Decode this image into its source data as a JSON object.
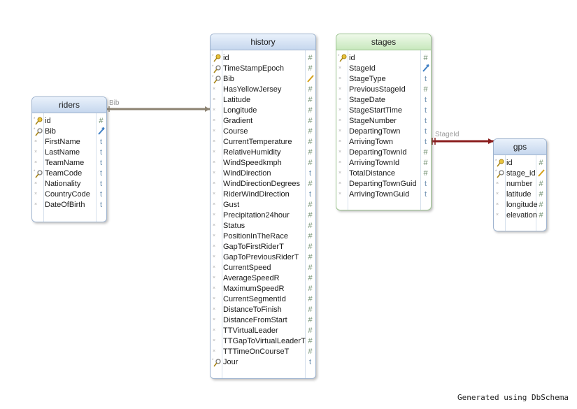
{
  "footer": "Generated using DbSchema",
  "relations": [
    {
      "label": "Bib",
      "from": "riders",
      "to": "history",
      "color": "#8c8271"
    },
    {
      "label": "StageId",
      "from": "stages",
      "to": "gps",
      "color": "#8b1e1e"
    }
  ],
  "tables": {
    "riders": {
      "title": "riders",
      "columns": [
        {
          "name": "id",
          "icon": "pk",
          "type": "#"
        },
        {
          "name": "Bib",
          "icon": "idx",
          "type": "fk"
        },
        {
          "name": "FirstName",
          "icon": "x",
          "type": "t"
        },
        {
          "name": "LastName",
          "icon": "x",
          "type": "t"
        },
        {
          "name": "TeamName",
          "icon": "x",
          "type": "t"
        },
        {
          "name": "TeamCode",
          "icon": "idx",
          "type": "t"
        },
        {
          "name": "Nationality",
          "icon": "x",
          "type": "t"
        },
        {
          "name": "CountryCode",
          "icon": "x",
          "type": "t"
        },
        {
          "name": "DateOfBirth",
          "icon": "x",
          "type": "t"
        }
      ]
    },
    "history": {
      "title": "history",
      "columns": [
        {
          "name": "id",
          "icon": "pk",
          "type": "#"
        },
        {
          "name": "TimeStampEpoch",
          "icon": "idx",
          "type": "#"
        },
        {
          "name": "Bib",
          "icon": "idx",
          "type": "fk2"
        },
        {
          "name": "HasYellowJersey",
          "icon": "x",
          "type": "#"
        },
        {
          "name": "Latitude",
          "icon": "x",
          "type": "#"
        },
        {
          "name": "Longitude",
          "icon": "x",
          "type": "#"
        },
        {
          "name": "Gradient",
          "icon": "x",
          "type": "#"
        },
        {
          "name": "Course",
          "icon": "x",
          "type": "#"
        },
        {
          "name": "CurrentTemperature",
          "icon": "x",
          "type": "#"
        },
        {
          "name": "RelativeHumidity",
          "icon": "x",
          "type": "#"
        },
        {
          "name": "WindSpeedkmph",
          "icon": "x",
          "type": "#"
        },
        {
          "name": "WindDirection",
          "icon": "x",
          "type": "t"
        },
        {
          "name": "WindDirectionDegrees",
          "icon": "x",
          "type": "#"
        },
        {
          "name": "RiderWindDirection",
          "icon": "x",
          "type": "t"
        },
        {
          "name": "Gust",
          "icon": "x",
          "type": "#"
        },
        {
          "name": "Precipitation24hour",
          "icon": "x",
          "type": "#"
        },
        {
          "name": "Status",
          "icon": "x",
          "type": "#"
        },
        {
          "name": "PositionInTheRace",
          "icon": "x",
          "type": "#"
        },
        {
          "name": "GapToFirstRiderT",
          "icon": "x",
          "type": "#"
        },
        {
          "name": "GapToPreviousRiderT",
          "icon": "x",
          "type": "#"
        },
        {
          "name": "CurrentSpeed",
          "icon": "x",
          "type": "#"
        },
        {
          "name": "AverageSpeedR",
          "icon": "x",
          "type": "#"
        },
        {
          "name": "MaximumSpeedR",
          "icon": "x",
          "type": "#"
        },
        {
          "name": "CurrentSegmentId",
          "icon": "x",
          "type": "#"
        },
        {
          "name": "DistanceToFinish",
          "icon": "x",
          "type": "#"
        },
        {
          "name": "DistanceFromStart",
          "icon": "x",
          "type": "#"
        },
        {
          "name": "TTVirtualLeader",
          "icon": "x",
          "type": "#"
        },
        {
          "name": "TTGapToVirtualLeaderT",
          "icon": "x",
          "type": "#"
        },
        {
          "name": "TTTimeOnCourseT",
          "icon": "x",
          "type": "#"
        },
        {
          "name": "Jour",
          "icon": "idx",
          "type": "t"
        }
      ]
    },
    "stages": {
      "title": "stages",
      "columns": [
        {
          "name": "id",
          "icon": "pk",
          "type": "#"
        },
        {
          "name": "StageId",
          "icon": "x",
          "type": "fk"
        },
        {
          "name": "StageType",
          "icon": "x",
          "type": "t"
        },
        {
          "name": "PreviousStageId",
          "icon": "x",
          "type": "#"
        },
        {
          "name": "StageDate",
          "icon": "x",
          "type": "t"
        },
        {
          "name": "StageStartTime",
          "icon": "x",
          "type": "t"
        },
        {
          "name": "StageNumber",
          "icon": "x",
          "type": "t"
        },
        {
          "name": "DepartingTown",
          "icon": "x",
          "type": "t"
        },
        {
          "name": "ArrivingTown",
          "icon": "x",
          "type": "t"
        },
        {
          "name": "DepartingTownId",
          "icon": "x",
          "type": "#"
        },
        {
          "name": "ArrivingTownId",
          "icon": "x",
          "type": "#"
        },
        {
          "name": "TotalDistance",
          "icon": "x",
          "type": "#"
        },
        {
          "name": "DepartingTownGuid",
          "icon": "x",
          "type": "t"
        },
        {
          "name": "ArrivingTownGuid",
          "icon": "x",
          "type": "t"
        }
      ]
    },
    "gps": {
      "title": "gps",
      "columns": [
        {
          "name": "id",
          "icon": "pk",
          "type": "#"
        },
        {
          "name": "stage_id",
          "icon": "idx",
          "type": "fk2"
        },
        {
          "name": "number",
          "icon": "x",
          "type": "#"
        },
        {
          "name": "latitude",
          "icon": "x",
          "type": "#"
        },
        {
          "name": "longitude",
          "icon": "x",
          "type": "#"
        },
        {
          "name": "elevation",
          "icon": "x",
          "type": "#"
        }
      ]
    }
  }
}
